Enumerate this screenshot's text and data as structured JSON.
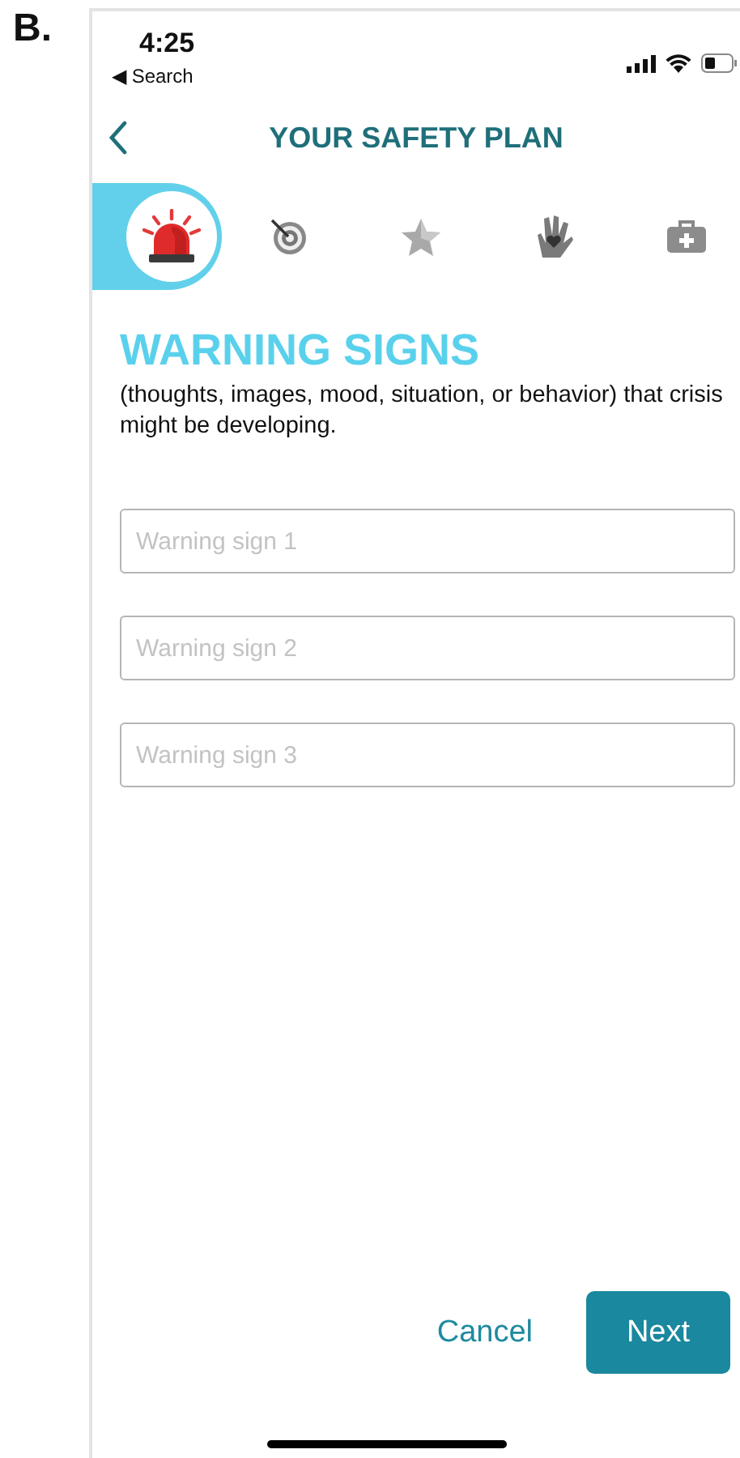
{
  "figure_label": "B.",
  "status_bar": {
    "time": "4:25",
    "back_link": "◀ Search"
  },
  "header": {
    "title": "YOUR SAFETY PLAN"
  },
  "steps": [
    {
      "kind": "siren",
      "selected": true
    },
    {
      "kind": "target",
      "selected": false
    },
    {
      "kind": "star",
      "selected": false
    },
    {
      "kind": "hand",
      "selected": false
    },
    {
      "kind": "medkit",
      "selected": false
    }
  ],
  "section": {
    "title": "WARNING SIGNS",
    "description": "(thoughts, images, mood, situation, or behavior) that crisis might be developing."
  },
  "fields": [
    {
      "placeholder": "Warning sign 1"
    },
    {
      "placeholder": "Warning sign 2"
    },
    {
      "placeholder": "Warning sign 3"
    }
  ],
  "buttons": {
    "cancel": "Cancel",
    "next": "Next"
  }
}
